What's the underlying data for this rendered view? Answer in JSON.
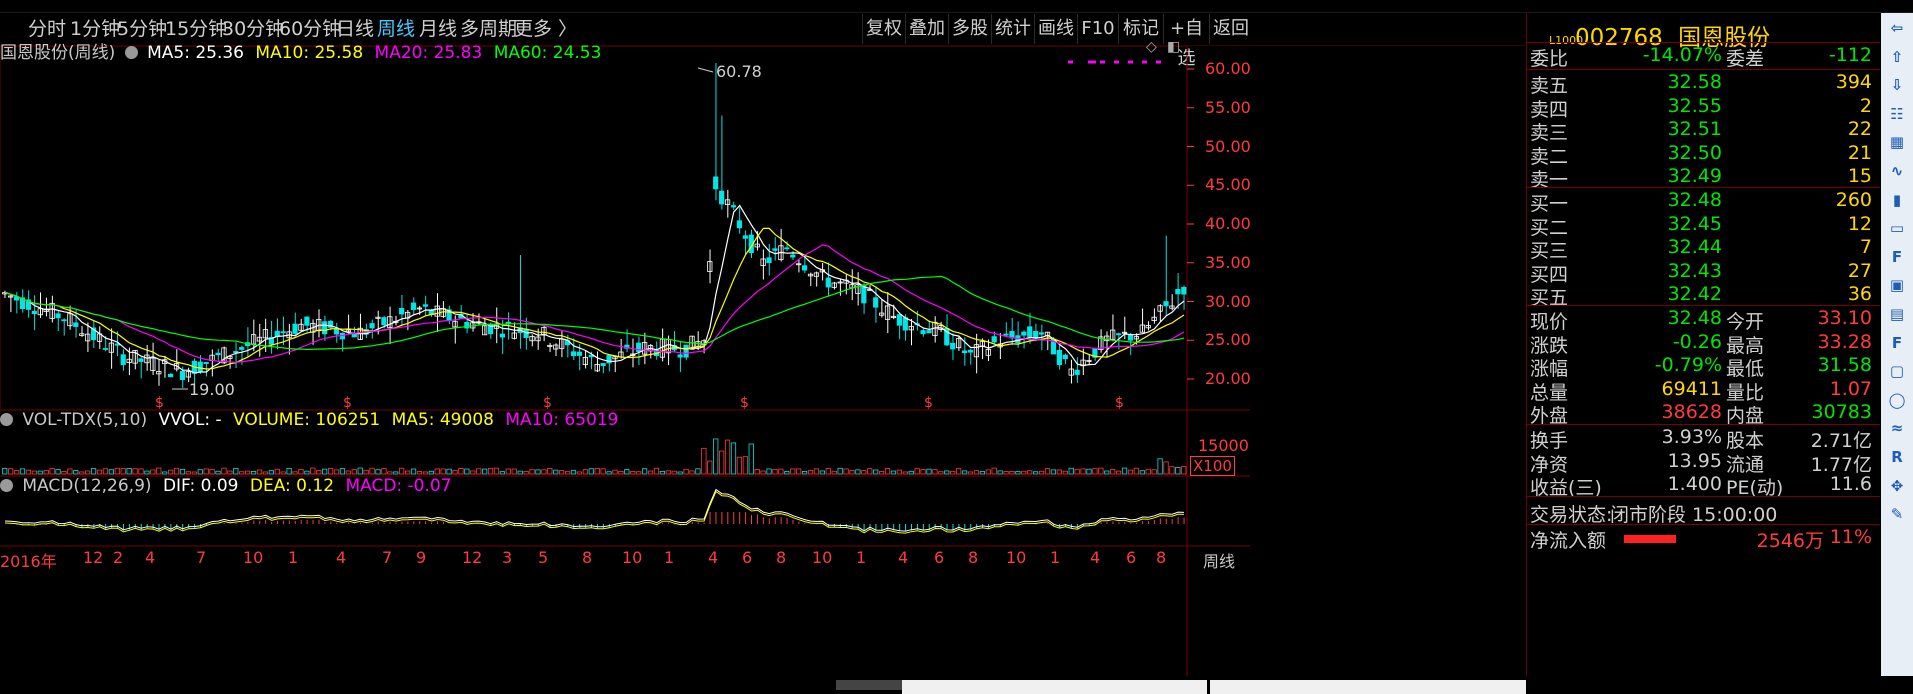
{
  "toolbar": {
    "periods": [
      "分时",
      "1分钟",
      "5分钟",
      "15分钟",
      "30分钟",
      "60分钟",
      "日线",
      "周线",
      "月线",
      "多周期",
      "更多 〉"
    ],
    "active_period": "周线",
    "right_buttons": [
      "复权",
      "叠加",
      "多股",
      "统计",
      "画线",
      "F10",
      "标记",
      "+自选",
      "返回"
    ]
  },
  "main_legend": {
    "title": "国恩股份(周线)",
    "ma5": "MA5: 25.36",
    "ma10": "MA10: 25.58",
    "ma20": "MA20: 25.83",
    "ma60": "MA60: 24.53"
  },
  "annotations": {
    "high": "60.78",
    "low": "19.00"
  },
  "price_axis": [
    "60.00",
    "55.00",
    "50.00",
    "45.00",
    "40.00",
    "35.00",
    "30.00",
    "25.00",
    "20.00"
  ],
  "vol_legend": {
    "title": "VOL-TDX(5,10)",
    "vvol": "VVOL: -",
    "volume": "VOLUME: 106251",
    "ma5": "MA5: 49008",
    "ma10": "MA10: 65019"
  },
  "vol_axis": {
    "tick": "15000",
    "multiplier": "X100"
  },
  "macd_legend": {
    "title": "MACD(12,26,9)",
    "dif": "DIF: 0.09",
    "dea": "DEA: 0.12",
    "macd": "MACD: -0.07"
  },
  "time_axis": [
    "2016年",
    "12",
    "2",
    "4",
    "7",
    "10",
    "1",
    "4",
    "7",
    "9",
    "12",
    "3",
    "5",
    "8",
    "10",
    "1",
    "4",
    "6",
    "8",
    "10",
    "1",
    "4",
    "6",
    "8",
    "10",
    "1",
    "4",
    "6",
    "8"
  ],
  "time_axis_label": "周线",
  "quote": {
    "code": "002768",
    "name": "国恩股份",
    "tag": "L1000",
    "weibi_label": "委比",
    "weibi": "-14.07%",
    "weicha_label": "委差",
    "weicha": "-112",
    "asks": [
      {
        "label": "卖五",
        "price": "32.58",
        "vol": "394"
      },
      {
        "label": "卖四",
        "price": "32.55",
        "vol": "2"
      },
      {
        "label": "卖三",
        "price": "32.51",
        "vol": "22"
      },
      {
        "label": "卖二",
        "price": "32.50",
        "vol": "21"
      },
      {
        "label": "卖一",
        "price": "32.49",
        "vol": "15"
      }
    ],
    "bids": [
      {
        "label": "买一",
        "price": "32.48",
        "vol": "260"
      },
      {
        "label": "买二",
        "price": "32.45",
        "vol": "12"
      },
      {
        "label": "买三",
        "price": "32.44",
        "vol": "7"
      },
      {
        "label": "买四",
        "price": "32.43",
        "vol": "27"
      },
      {
        "label": "买五",
        "price": "32.42",
        "vol": "36"
      }
    ],
    "stats": [
      {
        "l1": "现价",
        "v1": "32.48",
        "l2": "今开",
        "v2": "33.10"
      },
      {
        "l1": "涨跌",
        "v1": "-0.26",
        "l2": "最高",
        "v2": "33.28"
      },
      {
        "l1": "涨幅",
        "v1": "-0.79%",
        "l2": "最低",
        "v2": "31.58"
      },
      {
        "l1": "总量",
        "v1": "69411",
        "l2": "量比",
        "v2": "1.07"
      },
      {
        "l1": "外盘",
        "v1": "38628",
        "l2": "内盘",
        "v2": "30783"
      }
    ],
    "fund": [
      {
        "l1": "换手",
        "v1": "3.93%",
        "l2": "股本",
        "v2": "2.71亿"
      },
      {
        "l1": "净资",
        "v1": "13.95",
        "l2": "流通",
        "v2": "1.77亿"
      },
      {
        "l1": "收益(三)",
        "v1": "1.400",
        "l2": "PE(动)",
        "v2": "11.6"
      }
    ],
    "status_label": "交易状态:",
    "status": "闭市阶段 15:00:00",
    "netflow_label": "净流入额",
    "netflow": "2546万",
    "netflow_pct": "11%"
  },
  "colors": {
    "up": "#ff3b3b",
    "down": "#00e600",
    "price": "#ffd700",
    "ma5": "#ffffff",
    "ma10": "#ffff00",
    "ma20": "#ff00ff",
    "ma60": "#00ff00",
    "grid": "#7a0000"
  },
  "side_icons": [
    "back-arrow-icon",
    "up-arrow-icon",
    "down-arrow-icon",
    "list-icon",
    "table-icon",
    "line-chart-icon",
    "candle-icon",
    "window-icon",
    "f10-icon",
    "box-icon",
    "box2-icon",
    "f2-icon",
    "tag-icon",
    "circle-icon",
    "wave-icon",
    "rsi-icon",
    "cross-icon",
    "pen-icon"
  ]
}
